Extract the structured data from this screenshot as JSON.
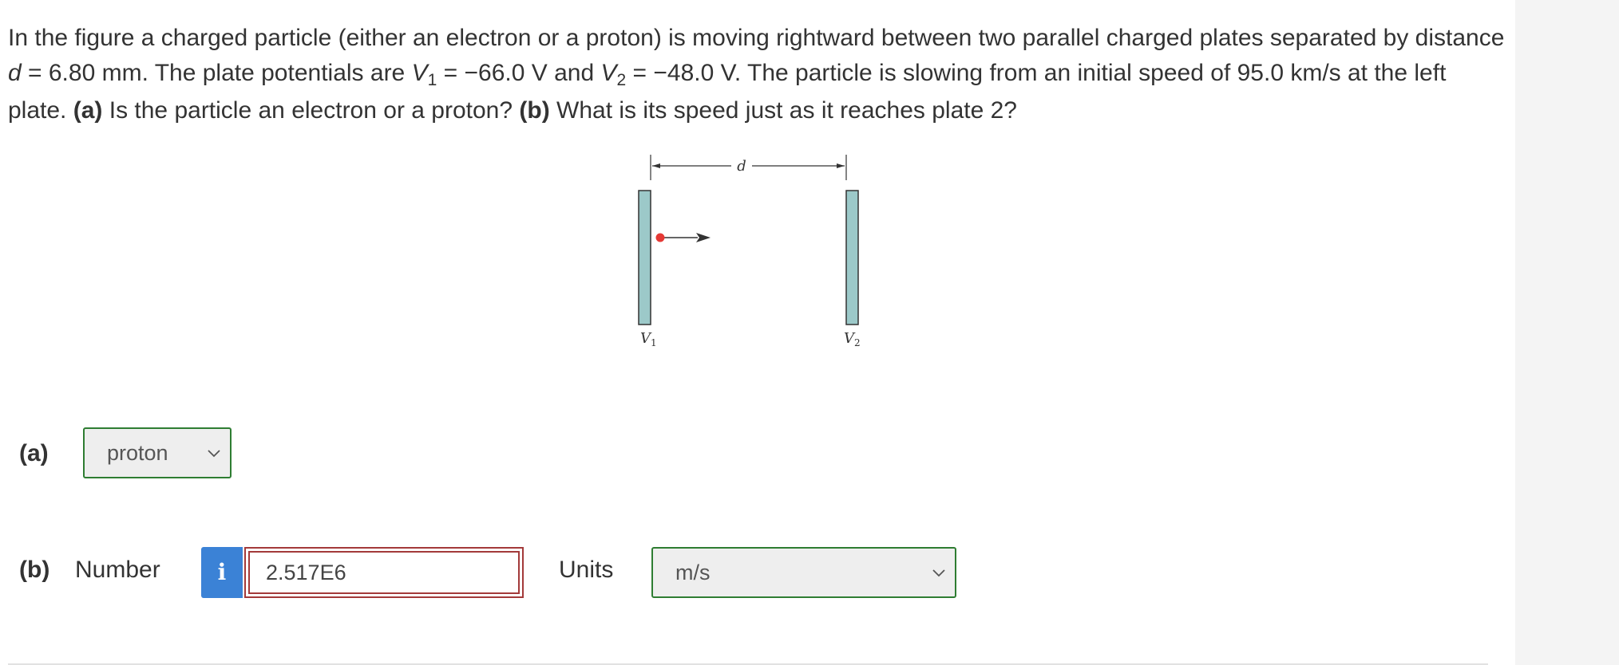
{
  "question": {
    "t1": "In the figure a charged particle (either an electron or a proton) is moving rightward between two parallel charged plates separated by distance ",
    "d_var": "d",
    "t2": " = 6.80 mm. The plate potentials are ",
    "v1_var": "V",
    "v1_sub": "1",
    "t3": " = −66.0 V and ",
    "v2_var": "V",
    "v2_sub": "2",
    "t4": " = −48.0 V. The particle is slowing from an initial speed of 95.0 km/s at the left plate. ",
    "a_label": "(a)",
    "t5": " Is the particle an electron or a proton? ",
    "b_label": "(b)",
    "t6": " What is its speed just as it reaches plate 2?"
  },
  "figure": {
    "d_label": "d",
    "v1_label": "V",
    "v1_sub": "1",
    "v2_label": "V",
    "v2_sub": "2",
    "plate_color": "#9cc9c9",
    "particle_color": "#e53935"
  },
  "part_a": {
    "label": "(a)",
    "selected": "proton"
  },
  "part_b": {
    "label": "(b)",
    "number_label": "Number",
    "info_glyph": "i",
    "value": "2.517E6",
    "units_label": "Units",
    "units_selected": "m/s"
  },
  "colors": {
    "correct_border": "#2e7d32",
    "incorrect_border": "#a33a3a",
    "info_blue": "#3b82d6"
  }
}
